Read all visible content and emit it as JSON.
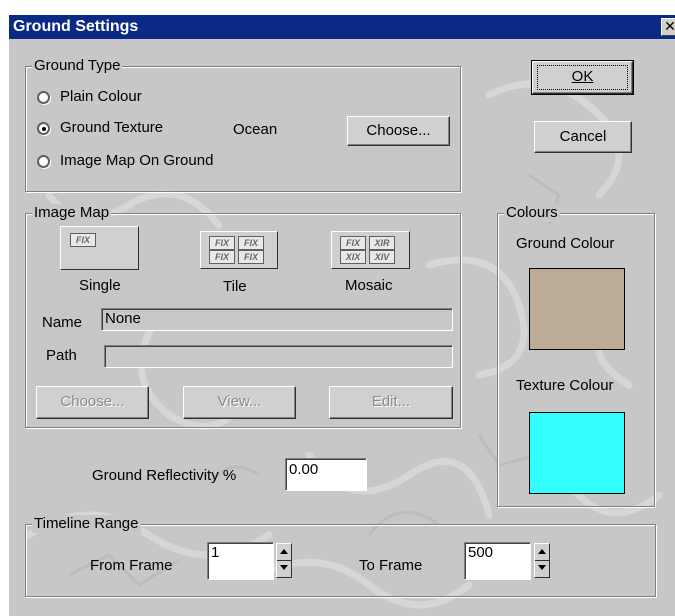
{
  "window": {
    "title": "Ground Settings",
    "close_glyph": "✕"
  },
  "ground_type": {
    "legend": "Ground Type",
    "options": [
      {
        "label": "Plain Colour",
        "selected": false
      },
      {
        "label": "Ground Texture",
        "selected": true
      },
      {
        "label": "Image Map On Ground",
        "selected": false
      }
    ],
    "texture_name": "Ocean",
    "choose_label": "Choose..."
  },
  "buttons": {
    "ok": "OK",
    "cancel": "Cancel"
  },
  "image_map": {
    "legend": "Image Map",
    "modes": [
      {
        "label": "Single",
        "tiles": [
          "FIX"
        ]
      },
      {
        "label": "Tile",
        "tiles": [
          "FIX",
          "FIX",
          "FIX",
          "FIX"
        ]
      },
      {
        "label": "Mosaic",
        "tiles": [
          "FIX",
          "XIR",
          "XIX",
          "XIV"
        ]
      }
    ],
    "name_label": "Name",
    "name_value": "None",
    "path_label": "Path",
    "path_value": "",
    "choose_label": "Choose...",
    "view_label": "View...",
    "edit_label": "Edit..."
  },
  "colours": {
    "legend": "Colours",
    "ground_label": "Ground Colour",
    "ground_color": "#bcac96",
    "texture_label": "Texture Colour",
    "texture_color": "#33ffff"
  },
  "reflectivity": {
    "label": "Ground Reflectivity %",
    "value": "0.00"
  },
  "timeline": {
    "legend": "Timeline Range",
    "from_label": "From Frame",
    "from_value": "1",
    "to_label": "To Frame",
    "to_value": "500"
  }
}
